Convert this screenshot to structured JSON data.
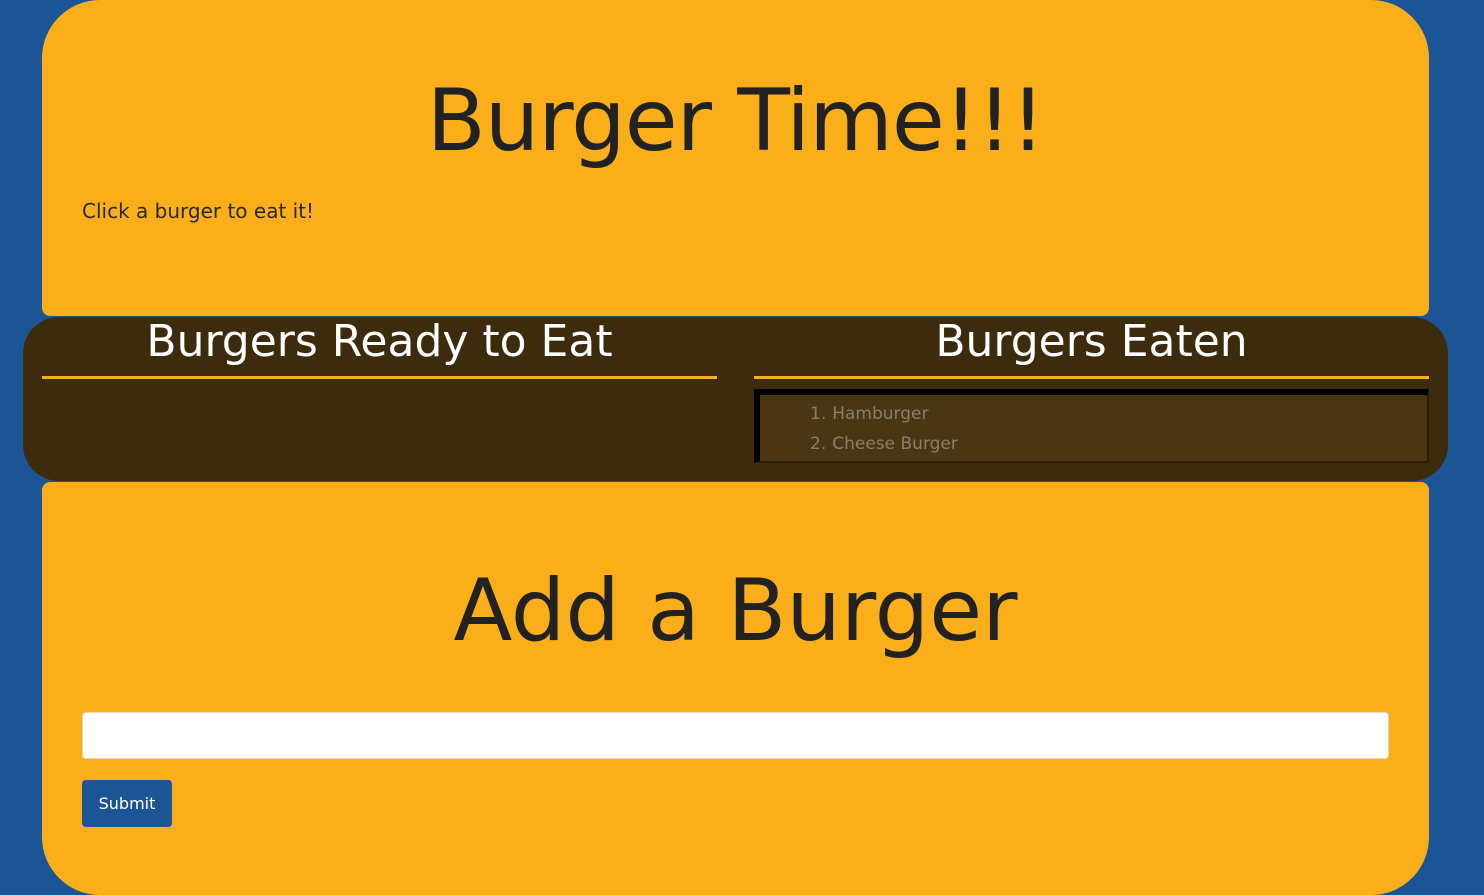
{
  "header": {
    "title": "Burger Time!!!",
    "subtitle": "Click a burger to eat it!"
  },
  "columns": {
    "ready": {
      "heading": "Burgers Ready to Eat",
      "items": []
    },
    "eaten": {
      "heading": "Burgers Eaten",
      "items": [
        {
          "number": "1.",
          "name": "Hamburger"
        },
        {
          "number": "2.",
          "name": "Cheese Burger"
        }
      ]
    }
  },
  "add_form": {
    "title": "Add a Burger",
    "input_value": "",
    "submit_label": "Submit"
  },
  "colors": {
    "background": "#1b5596",
    "bun": "#f9ae1a",
    "patty": "#3c2c0d",
    "button": "#1b5596"
  }
}
